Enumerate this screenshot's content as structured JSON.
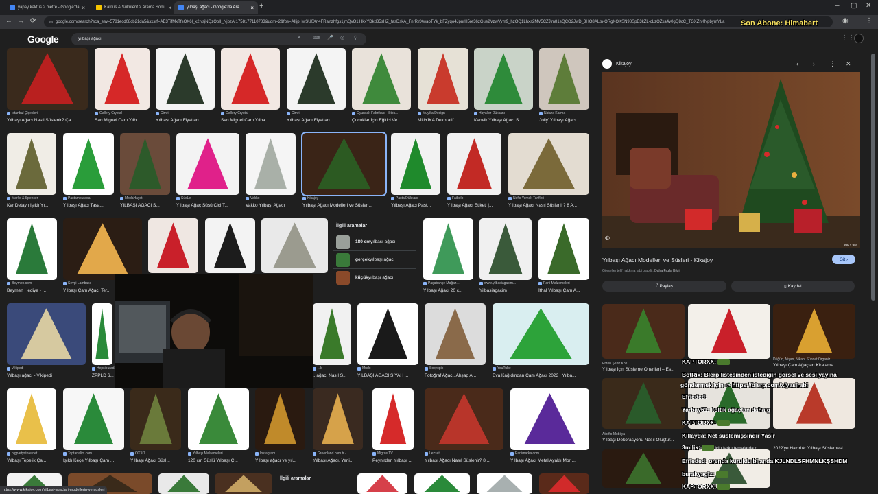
{
  "browser": {
    "tabs": [
      {
        "label": "yapay kaktüs 2 metre - Google'da Ara",
        "color": "#4285f4",
        "active": false
      },
      {
        "label": "Kaktüs & Sukulent > Arama Sonu",
        "color": "#f5c400",
        "active": false
      },
      {
        "label": "yılbaşı ağacı - Google'da Ara",
        "color": "#4285f4",
        "active": true
      }
    ],
    "new_tab": "+",
    "url": "google.com/search?sca_esv=5781ecd08cb21da5&sxsrf=AE3TifMxTfsOX6l_x2NsjNQzOoII_NjpzA:1758177110783&udm=2&fbs=AIIjpHwSU0Xn4FRaYzhfgs1jmQvO1iHkxYDkd35sHZ_fasDskA_FnrRYXwaoTYk_bFZyqo4JpnrH5re36zGue2VzwVym9_hzOQ1Lhxs2MV5CZJim81eQCO2JwD_3HO8ALtn-ORgXOKSN98SpE3kZL-cLzOZxa4v0gQ8cC_TGXZhKNpbymYLa",
    "overlay_name": "Son Abone: Himabert"
  },
  "search": {
    "logo": "Google",
    "query": "yılbaşı ağacı"
  },
  "grid": [
    {
      "src": "İstanbul Çiçekleri",
      "title": "Yılbaşı Ağacı Nasıl Süslenir? Ça...",
      "c1": "#3a2a1c",
      "c2": "#b9201f"
    },
    {
      "src": "Gallery Crystal",
      "title": "San Miguel Cam Yılb...",
      "c1": "#f2e8e3",
      "c2": "#d62828"
    },
    {
      "src": "Cimri",
      "title": "Yılbaşı Ağacı Fiyatları ...",
      "c1": "#f4f4f4",
      "c2": "#2b3a2b"
    },
    {
      "src": "Gallery Crystal",
      "title": "San Miguel Cam Yılba...",
      "c1": "#f2e8e3",
      "c2": "#d62828"
    },
    {
      "src": "Cimri",
      "title": "Yılbaşı Ağacı Fiyatları ...",
      "c1": "#f4f4f4",
      "c2": "#2b3a2b"
    },
    {
      "src": "Oyuncak Fabrikası · Stok...",
      "title": "Çocuklar İçin Eğitici Ve...",
      "c1": "#e9e2da",
      "c2": "#3f8a3c"
    },
    {
      "src": "Muyika Design",
      "title": "MUYİKA Dekoratif ...",
      "c1": "#e6e1d6",
      "c2": "#c93b2d"
    },
    {
      "src": "Hayaller Dükkanı",
      "title": "Kanvik Yılbaşı Ağacı S...",
      "c1": "#c9d3c8",
      "c2": "#2e8b3a"
    },
    {
      "src": "Natura Karma",
      "title": "Jolly' Yılbaşı Ağacı...",
      "c1": "#cfc6bd",
      "c2": "#5e7d3a"
    },
    {
      "src": "Marks & Spencer",
      "title": "Kar Detaylı Işıklı Yı...",
      "c1": "#f0ede6",
      "c2": "#6b6a3c"
    },
    {
      "src": "Pastamburada",
      "title": "Yılbaşı Ağacı Tasa...",
      "c1": "#ffffff",
      "c2": "#2a9d3a"
    },
    {
      "src": "ModaHayat",
      "title": "YILBAŞI AĞACI S...",
      "c1": "#6a4b3a",
      "c2": "#2d5a2a"
    },
    {
      "src": "SüsLe",
      "title": "Yılbaşı Ağaç Süsü Cici T...",
      "c1": "#f3f3f3",
      "c2": "#e0218a"
    },
    {
      "src": "Vakko",
      "title": "Vakko Yılbaşı Ağacı",
      "c1": "#f5f5f5",
      "c2": "#a9b0a8"
    },
    {
      "src": "Kikajoy",
      "title": "Yılbaşı Ağacı Modelleri ve Süsleri...",
      "c1": "#3a2417",
      "c2": "#2c5a22"
    },
    {
      "src": "Pasta Dükkanı",
      "title": "Yılbaşı Ağacı Past...",
      "c1": "#f2f2f2",
      "c2": "#1f8a2c"
    },
    {
      "src": "Faibelo",
      "title": "Yılbaşı Ağacı Etiketi |...",
      "c1": "#f1f1f1",
      "c2": "#c22a25"
    },
    {
      "src": "Nefis Yemek Tarifleri",
      "title": "Yılbaşı Ağacı Nasıl Süslenir? 8 A...",
      "c1": "#e3dcd1",
      "c2": "#7b6a3a"
    },
    {
      "src": "Beymen.com",
      "title": "Beymen Hediye - ...",
      "c1": "#ffffff",
      "c2": "#2a7a3a"
    },
    {
      "src": "Sevgi Lambası",
      "title": "Yılbaşı Çam Ağacı Ter...",
      "c1": "#2b1d14",
      "c2": "#e2a84a"
    },
    {
      "src": "",
      "title": "",
      "c1": "#efe7e2",
      "c2": "#c9202a"
    },
    {
      "src": "",
      "title": "",
      "c1": "#f3f3f3",
      "c2": "#1c1c1c"
    },
    {
      "src": "",
      "title": "",
      "c1": "#e9e9e9",
      "c2": "#9b9b8f"
    },
    {
      "src": "Paşabahçe Mağaz...",
      "title": "Yılbaşı Ağacı 20 c...",
      "c1": "#ffffff",
      "c2": "#3f9a5a"
    },
    {
      "src": "www.yilbasiagacim...",
      "title": "Yilbasiagacim",
      "c1": "#f0f0f0",
      "c2": "#3a5a3a"
    },
    {
      "src": "Parti Malzemeleri",
      "title": "İthal Yılbaşı Çam A...",
      "c1": "#ffffff",
      "c2": "#3a6a2a"
    },
    {
      "src": "Vikipedi",
      "title": "Yılbaşı ağacı - Vikipedi",
      "c1": "#3a4a7a",
      "c2": "#d6c9a0"
    },
    {
      "src": "Hepsiburada",
      "title": "ZPPLD 6...",
      "c1": "#ffffff",
      "c2": "#2a8a3a"
    },
    {
      "src": "...b",
      "title": "...ağacı Nasıl S...",
      "c1": "#f1f1f1",
      "c2": "#3a7a2a"
    },
    {
      "src": "Mudo",
      "title": "YILBAŞI AĞACI SİYAH ...",
      "c1": "#ffffff",
      "c2": "#1a1a1a"
    },
    {
      "src": "Sosyopix",
      "title": "Fotoğraf Ağacı, Ahşap A...",
      "c1": "#dcdcdc",
      "c2": "#8a6a4a"
    },
    {
      "src": "YouTube",
      "title": "Eva Kağıdından Çam Ağacı 2023 | Yılba...",
      "c1": "#d9eef0",
      "c2": "#2da33a"
    },
    {
      "src": "bigpartystore.net",
      "title": "Yılbaşı Tepelik Ça...",
      "c1": "#ffffff",
      "c2": "#e9c04a"
    },
    {
      "src": "Toptanalim.com",
      "title": "Işıklı Keçe Yılbaşı Çam ...",
      "c1": "#f7f7f7",
      "c2": "#2a8a3a"
    },
    {
      "src": "OXXO",
      "title": "Yılbaşı Ağacı Süsl...",
      "c1": "#3a2a1a",
      "c2": "#6a7a3a"
    },
    {
      "src": "Yılbaşı Malzemeleri",
      "title": "120 cm Süslü Yılbaşı Ç...",
      "c1": "#ffffff",
      "c2": "#3a8a3a"
    },
    {
      "src": "Instagram",
      "title": "Yılbaşı ağacı ve yıl...",
      "c1": "#2a1a10",
      "c2": "#c08a2a"
    },
    {
      "src": "Greenland.com.tr · ...",
      "title": "Yılbaşı Ağacı, Yeni...",
      "c1": "#3a2a20",
      "c2": "#d6a24a"
    },
    {
      "src": "Migros TV",
      "title": "Peynirden Yılbaşı ...",
      "c1": "#ffffff",
      "c2": "#d62a2a"
    },
    {
      "src": "Lezzet",
      "title": "Yılbaşı Ağacı Nasıl Süslenir? 8 ...",
      "c1": "#4a2a1a",
      "c2": "#b8352a"
    },
    {
      "src": "Partimarka.com",
      "title": "Yılbaşı Ağacı Metal Ayaklı Mor ...",
      "c1": "#ffffff",
      "c2": "#5a2a9a"
    },
    {
      "src": "",
      "title": "",
      "c1": "#f3f3f3",
      "c2": "#3a7a3a"
    },
    {
      "src": "",
      "title": "",
      "c1": "#7a4a2a",
      "c2": "#3a2a1a"
    },
    {
      "src": "",
      "title": "",
      "c1": "#e9e9e9",
      "c2": "#3a7a3a"
    },
    {
      "src": "",
      "title": "",
      "c1": "#4a3020",
      "c2": "#c3a060"
    },
    {
      "src": "",
      "title": "",
      "c1": "#ffffff",
      "c2": "#d6404a"
    },
    {
      "src": "",
      "title": "",
      "c1": "#ffffff",
      "c2": "#2a8a3a"
    },
    {
      "src": "",
      "title": "",
      "c1": "#ffffff",
      "c2": "#a8b0b0"
    },
    {
      "src": "",
      "title": "",
      "c1": "#5a2a1a",
      "c2": "#d12a2a"
    }
  ],
  "related": {
    "heading": "İlgili aramalar",
    "items": [
      {
        "bold": "180 cm",
        "rest": " yılbaşı ağacı",
        "color": "#9aa09a"
      },
      {
        "bold": "gerçek",
        "rest": " yılbaşı ağacı",
        "color": "#3a7a3a"
      },
      {
        "bold": "küçük",
        "rest": " yılbaşı ağacı",
        "color": "#8a4a2a"
      }
    ],
    "heading2": "İlgili aramalar"
  },
  "panel": {
    "source": "Kikajoy",
    "title": "Yılbaşı Ağacı Modelleri ve Süsleri - Kikajoy",
    "copyright": "Görseller telif hakkına tabi olabilir.",
    "learn_more": "Daha Fazla Bilgi",
    "visit": "Git",
    "share": "Paylaş",
    "save": "Kaydet",
    "dims": "980 × 654",
    "related_items": [
      {
        "src": "Erzen Şehir Koru",
        "title": "Yılbaşı İçin Süsleme Önerileri – Es...",
        "c1": "#4a2a1a",
        "c2": "#3a7a2a"
      },
      {
        "src": "",
        "title": "",
        "c1": "#f3f0ea",
        "c2": "#c9202a"
      },
      {
        "src": "Düğün, Nişan, Nikah, Sünnet Organiz...",
        "title": "Yılbaşı Çam Ağaçları Kiralama",
        "c1": "#3a2010",
        "c2": "#d9a030"
      },
      {
        "src": "Atorflo Mobilya",
        "title": "Yılbaşı Dekorasyonu Nasıl Oluştur...",
        "c1": "#3a2a1a",
        "c2": "#2a5a2a"
      },
      {
        "src": "",
        "title": "Yılbaşı ağacı için farklı temalarda d...",
        "c1": "#e6e3dd",
        "c2": "#2a6a2a"
      },
      {
        "src": "",
        "title": "2022'ye Hazırlık: Yılbaşı Süslemesi...",
        "c1": "#efe8e0",
        "c2": "#b93a2a"
      },
      {
        "src": "",
        "title": "",
        "c1": "#2a1a10",
        "c2": "#3a6a2a"
      },
      {
        "src": "",
        "title": "",
        "c1": "#f1ede6",
        "c2": "#3a5a3a"
      }
    ]
  },
  "chat": [
    {
      "name": "KAPTORXX",
      "msg": ": ",
      "badge": true
    },
    {
      "name": "BotRix",
      "msg": ": Blerp listesinden istediğin görsel ve sesi yayına"
    },
    {
      "name": "",
      "msg": "göndermek için -> https://blerp.com/x/yasirabi"
    },
    {
      "name": "Efrieded",
      "msg": ":"
    },
    {
      "name": "Yarbay61",
      "msg": ": koltik ağaçtan daha g"
    },
    {
      "name": "KAPTORXX",
      "msg": ": ",
      "badge": true
    },
    {
      "name": "Killayda",
      "msg": ": Net süslemişsindir Yasir"
    },
    {
      "name": "3milik",
      "msg": ": ",
      "badge": true
    },
    {
      "name": "Efrieded",
      "msg": ": orenda kuruldu bi anda KJLNDLSFHMNLKŞSHDM"
    },
    {
      "name": "burakyagiz",
      "msg": ": ",
      "badge": true
    },
    {
      "name": "KAPTORXX",
      "msg": ": ",
      "badge": true
    }
  ],
  "status_url": "https://www.kikajoy.com/yilbasi-agaclari-modellerin-ve-susleri"
}
